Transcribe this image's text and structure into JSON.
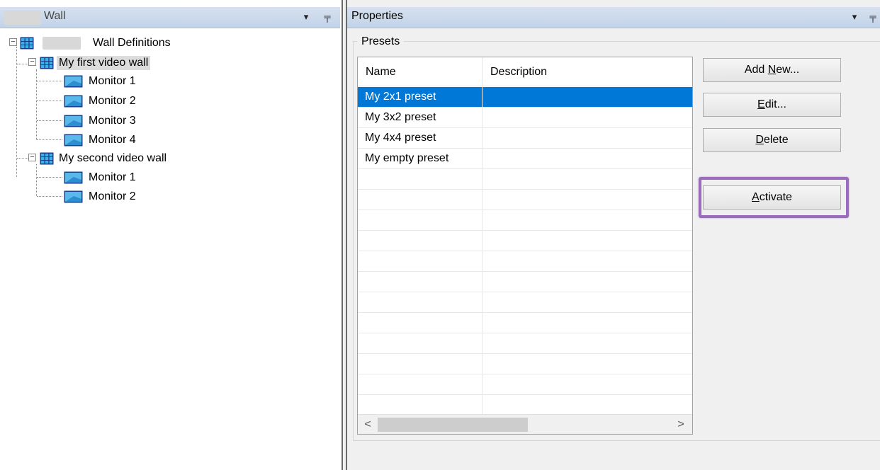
{
  "left_panel": {
    "title": "Wall",
    "dropdown_icon": "dropdown-arrow-icon",
    "pin_icon": "pin-icon",
    "tree": {
      "root": {
        "label": "Wall Definitions",
        "icon": "video-wall-grid-icon",
        "expander": "⊟"
      },
      "walls": [
        {
          "label": "My first video wall",
          "icon": "video-wall-grid-icon",
          "expander": "⊟",
          "monitors": [
            "Monitor 1",
            "Monitor 2",
            "Monitor 3",
            "Monitor 4"
          ]
        },
        {
          "label": "My second video wall",
          "icon": "video-wall-grid-icon",
          "expander": "⊟",
          "monitors": [
            "Monitor 1",
            "Monitor 2"
          ]
        }
      ]
    }
  },
  "right_panel": {
    "title": "Properties",
    "dropdown_icon": "dropdown-arrow-icon",
    "pin_icon": "pin-icon",
    "group_label": "Presets",
    "list": {
      "columns": [
        "Name",
        "Description"
      ],
      "rows": [
        {
          "name": "My 2x1 preset",
          "description": "",
          "selected": true
        },
        {
          "name": "My 3x2 preset",
          "description": "",
          "selected": false
        },
        {
          "name": "My 4x4 preset",
          "description": "",
          "selected": false
        },
        {
          "name": "My empty preset",
          "description": "",
          "selected": false
        }
      ],
      "scroll_left": "<",
      "scroll_right": ">"
    },
    "buttons": {
      "add_new_prefix": "Add ",
      "add_new_mnemonic": "N",
      "add_new_suffix": "ew...",
      "edit_mnemonic": "E",
      "edit_suffix": "dit...",
      "delete_mnemonic": "D",
      "delete_suffix": "elete",
      "activate_mnemonic": "A",
      "activate_suffix": "ctivate"
    },
    "highlight_color": "#9b6bbd",
    "selection_color": "#0078d7"
  },
  "header_gradient": [
    "#d6e1ef",
    "#c2d3e8"
  ]
}
